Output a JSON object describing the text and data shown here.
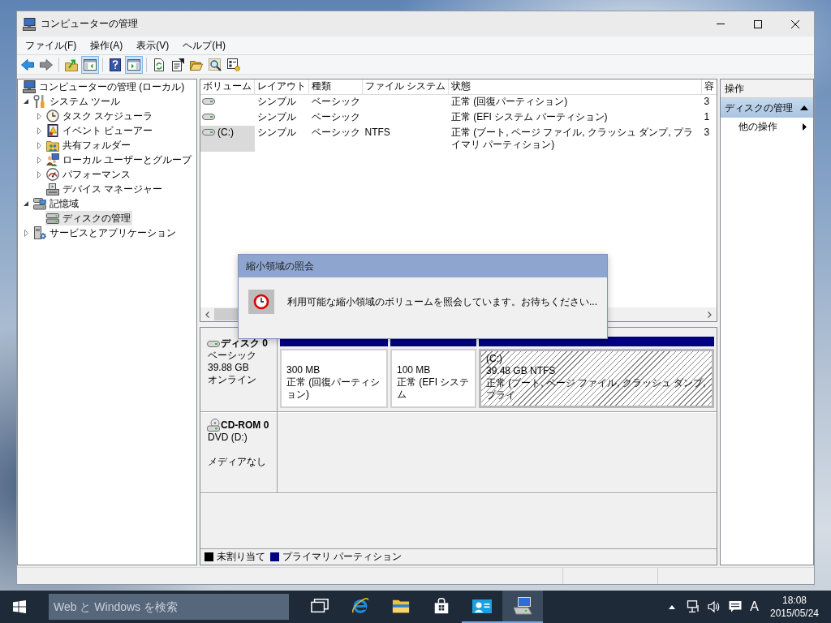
{
  "window": {
    "title": "コンピューターの管理"
  },
  "menu": [
    "ファイル(F)",
    "操作(A)",
    "表示(V)",
    "ヘルプ(H)"
  ],
  "toolbar": [
    {
      "pressed": false
    },
    {
      "pressed": false
    },
    {
      "pressed": false
    },
    {
      "pressed": true
    },
    {
      "pressed": false
    },
    {
      "pressed": true
    },
    {
      "pressed": false
    },
    {
      "pressed": false
    },
    {
      "pressed": false
    },
    {
      "pressed": false
    },
    {
      "pressed": false
    }
  ],
  "tree": [
    {
      "label": "コンピューターの管理 (ローカル)",
      "selected": false,
      "children": [
        {
          "label": "システム ツール",
          "expanded": true,
          "selected": false,
          "children": [
            {
              "label": "タスク スケジューラ",
              "expanded": false,
              "selected": false
            },
            {
              "label": "イベント ビューアー",
              "expanded": false,
              "selected": false
            },
            {
              "label": "共有フォルダー",
              "expanded": false,
              "selected": false
            },
            {
              "label": "ローカル ユーザーとグループ",
              "expanded": false,
              "selected": false
            },
            {
              "label": "パフォーマンス",
              "expanded": false,
              "selected": false
            },
            {
              "label": "デバイス マネージャー",
              "selected": false
            }
          ]
        },
        {
          "label": "記憶域",
          "expanded": true,
          "selected": false,
          "children": [
            {
              "label": "ディスクの管理",
              "selected": true
            }
          ]
        },
        {
          "label": "サービスとアプリケーション",
          "expanded": false,
          "selected": false
        }
      ]
    }
  ],
  "volume_list": {
    "columns": [
      "ボリューム",
      "レイアウト",
      "種類",
      "ファイル システム",
      "状態",
      "容"
    ],
    "rows": [
      {
        "layout": "シンプル",
        "type": "ベーシック",
        "status": "正常 (回復パーティション)",
        "column_6": "3",
        "selected": false
      },
      {
        "layout": "シンプル",
        "type": "ベーシック",
        "status": "正常 (EFI システム パーティション)",
        "column_6": "1",
        "selected": false
      },
      {
        "volume": "(C:)",
        "layout": "シンプル",
        "type": "ベーシック",
        "file_system": "NTFS",
        "status": "正常 (ブート, ページ ファイル, クラッシュ ダンプ, プライマリ パーティション)",
        "column_6": "3",
        "selected": true
      }
    ]
  },
  "disks": [
    {
      "kind": "disk",
      "name": "ディスク 0",
      "type": "ベーシック",
      "size": "39.88 GB",
      "status": "オンライン",
      "partitions": [
        {
          "size": "300 MB",
          "status": "正常 (回復パーティション)",
          "color": "#000080",
          "selected": false
        },
        {
          "size": "100 MB",
          "status": "正常 (EFI システム",
          "color": "#000080",
          "selected": false
        },
        {
          "label": "(C:)",
          "size": "39.48 GB NTFS",
          "status": "正常 (ブート, ページ ファイル, クラッシュ ダンプ, プライ",
          "color": "#000080",
          "selected": true
        }
      ]
    },
    {
      "kind": "cdrom",
      "name": "CD-ROM 0",
      "type": "DVD (D:)",
      "status": "メディアなし"
    }
  ],
  "legend": [
    {
      "label": "未割り当て",
      "color": "#000000"
    },
    {
      "label": "プライマリ パーティション",
      "color": "#000080"
    }
  ],
  "actions": {
    "title": "操作",
    "sections": [
      {
        "label": "ディスクの管理",
        "expanded": true,
        "items": [
          {
            "label": "他の操作",
            "submenu": true
          }
        ]
      }
    ]
  },
  "dialog": {
    "title": "縮小領域の照会",
    "message": "利用可能な縮小領域のボリュームを照会しています。お待ちください..."
  },
  "taskbar": {
    "search": {
      "placeholder": "Web と Windows を検索"
    },
    "apps": [
      {
        "running": false,
        "active": false
      },
      {
        "running": false,
        "active": false
      },
      {
        "running": false,
        "active": false
      },
      {
        "running": false,
        "active": false
      },
      {
        "running": true,
        "active": false
      },
      {
        "running": true,
        "active": true
      }
    ],
    "ime": "A",
    "time": "18:08",
    "date": "2015/05/24"
  }
}
